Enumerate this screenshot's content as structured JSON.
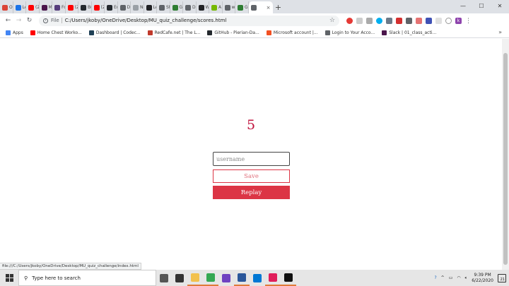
{
  "browser": {
    "tabs": [
      {
        "label": "Or",
        "icon": "gmail-icon",
        "color": "#db4437"
      },
      {
        "label": "Le",
        "icon": "page-icon",
        "color": "#1a73e8"
      },
      {
        "label": "(2)",
        "icon": "youtube-icon",
        "color": "#ff0000"
      },
      {
        "label": "M",
        "icon": "slack-icon",
        "color": "#4a154b"
      },
      {
        "label": "Fo",
        "icon": "bootstrap-icon",
        "color": "#563d7c"
      },
      {
        "label": "(2)",
        "icon": "youtube-icon",
        "color": "#ff0000"
      },
      {
        "label": "Bu",
        "icon": "github-icon",
        "color": "#24292e"
      },
      {
        "label": "(2)",
        "icon": "youtube-icon",
        "color": "#ff0000"
      },
      {
        "label": "Ed",
        "icon": "github-icon",
        "color": "#24292e"
      },
      {
        "label": "Di",
        "icon": "globe-icon",
        "color": "#5f6368"
      },
      {
        "label": "New T",
        "icon": "newtab-icon",
        "color": "#9aa0a6"
      },
      {
        "label": "Le",
        "icon": "generic-icon",
        "color": "#202124"
      },
      {
        "label": "St",
        "icon": "globe-icon",
        "color": "#5f6368"
      },
      {
        "label": "Gi",
        "icon": "generic-icon",
        "color": "#2e7d32"
      },
      {
        "label": "Di",
        "icon": "globe-icon",
        "color": "#5f6368"
      },
      {
        "label": "W",
        "icon": "generic-icon",
        "color": "#202124"
      },
      {
        "label": "A",
        "icon": "generic-icon",
        "color": "#76b900"
      },
      {
        "label": "w",
        "icon": "generic-icon",
        "color": "#5f6368"
      },
      {
        "label": "Gi",
        "icon": "generic-icon",
        "color": "#2e7d32"
      },
      {
        "label": "",
        "icon": "globe-icon",
        "color": "#5f6368",
        "active": true
      }
    ],
    "new_tab_symbol": "+",
    "window_controls": {
      "minimize": "—",
      "maximize": "☐",
      "close": "✕"
    },
    "address": {
      "scheme_label": "File",
      "url": "C:/Users/jkoby/OneDrive/Desktop/MU_quiz_challenge/scores.html"
    },
    "profile_initial": "k",
    "bookmarks": [
      {
        "label": "Apps",
        "icon": "apps-grid-icon",
        "color": "#4285f4"
      },
      {
        "label": "Home Chest Worko...",
        "icon": "youtube-icon",
        "color": "#ff0000"
      },
      {
        "label": "Dashboard | Codec...",
        "icon": "codecademy-icon",
        "color": "#1f4056"
      },
      {
        "label": "RedCafe.net | The L...",
        "icon": "redcafe-icon",
        "color": "#c0392b"
      },
      {
        "label": "GitHub - Pierian-Da...",
        "icon": "github-icon",
        "color": "#24292e"
      },
      {
        "label": "Microsoft account |...",
        "icon": "microsoft-icon",
        "color": "#f25022"
      },
      {
        "label": "Login to Your Acco...",
        "icon": "globe-icon",
        "color": "#5f6368"
      },
      {
        "label": "Slack | 01_class_acti...",
        "icon": "slack-icon",
        "color": "#4a154b"
      }
    ],
    "status_url": "file:///C:/Users/jkoby/OneDrive/Desktop/MU_quiz_challenge/index.html"
  },
  "page": {
    "score": "5",
    "username_placeholder": "username",
    "save_label": "Save",
    "replay_label": "Replay",
    "colors": {
      "score": "#c0123c",
      "button": "#dc3545"
    }
  },
  "taskbar": {
    "search_placeholder": "Type here to search",
    "pinned": [
      {
        "icon": "task-view-icon",
        "color": "#555555"
      },
      {
        "icon": "cortana-icon",
        "color": "#333333"
      },
      {
        "icon": "file-explorer-icon",
        "color": "#f2c14e",
        "open": true
      },
      {
        "icon": "chrome-icon",
        "color": "#34a853",
        "open": true
      },
      {
        "icon": "github-desktop-icon",
        "color": "#6f42c1"
      },
      {
        "icon": "word-icon",
        "color": "#2b579a",
        "open": true
      },
      {
        "icon": "vscode-icon",
        "color": "#0078d4"
      },
      {
        "icon": "slack-icon",
        "color": "#e01e5a",
        "open": true
      },
      {
        "icon": "terminal-icon",
        "color": "#111111",
        "open": true
      }
    ],
    "time": "9:39 PM",
    "date": "6/22/2020",
    "notification_count": "21"
  }
}
